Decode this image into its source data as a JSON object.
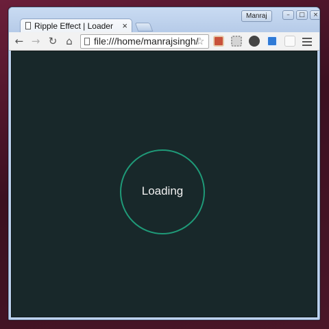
{
  "window": {
    "profile_name": "Manraj",
    "controls": {
      "minimize": "–",
      "maximize": "□",
      "close": "×"
    }
  },
  "tab": {
    "title": "Ripple Effect | Loader",
    "close": "×",
    "icon": "document-icon"
  },
  "toolbar": {
    "back": "←",
    "forward": "→",
    "reload": "↻",
    "home": "⌂",
    "url": "file:///home/manrajsingh/",
    "star": "☆"
  },
  "extensions": [
    "pocket-icon",
    "gear-extension-icon",
    "mail-icon",
    "tag-icon",
    "shortcut-icon"
  ],
  "page": {
    "loader_text": "Loading",
    "background": "#18282a",
    "ring_color": "#1f9a78"
  }
}
